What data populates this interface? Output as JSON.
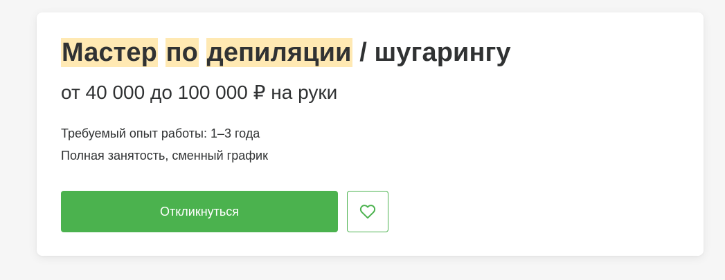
{
  "vacancy": {
    "title": {
      "highlighted": [
        "Мастер",
        "по",
        "депиляции"
      ],
      "rest": "/ шугарингу"
    },
    "salary": "от 40 000 до 100 000 ₽ на руки",
    "experience": "Требуемый опыт работы: 1–3 года",
    "employment": "Полная занятость, сменный график"
  },
  "actions": {
    "apply_label": "Откликнуться",
    "favorite_icon": "heart-icon"
  },
  "colors": {
    "accent": "#4bb24e",
    "highlight": "#ffe9b3",
    "text": "#303233"
  }
}
